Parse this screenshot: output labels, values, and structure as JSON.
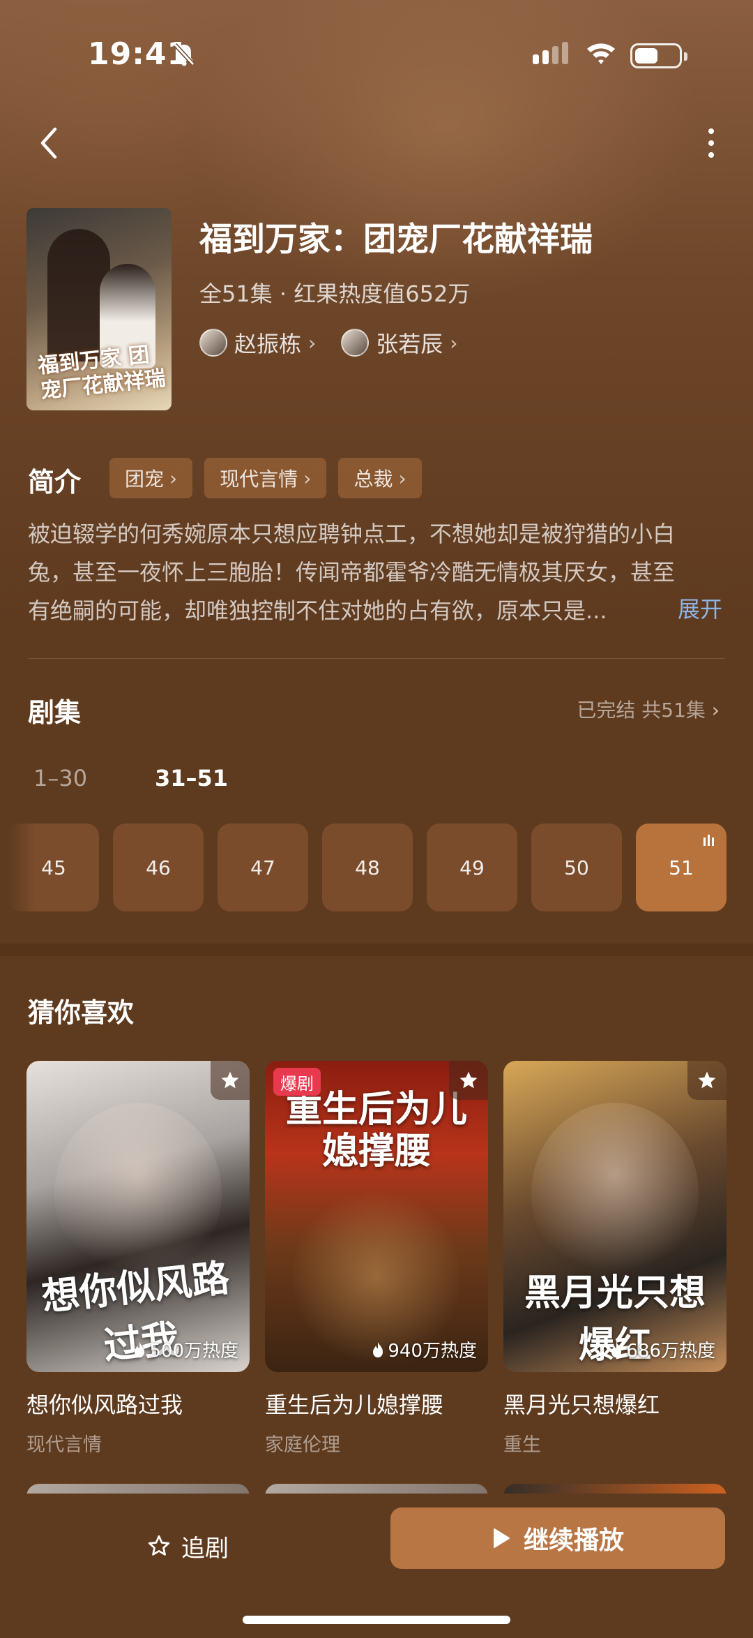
{
  "status_bar": {
    "time": "19:41"
  },
  "header": {
    "poster_text": "福到万家 团宠厂花献祥瑞",
    "title": "福到万家：团宠厂花献祥瑞",
    "meta": "全51集 · 红果热度值652万",
    "actors": [
      {
        "name": "赵振栋"
      },
      {
        "name": "张若辰"
      }
    ]
  },
  "intro": {
    "label": "简介",
    "tags": [
      "团宠",
      "现代言情",
      "总裁"
    ],
    "lines": [
      "被迫辍学的何秀婉原本只想应聘钟点工，不想她却是被狩猎的小白",
      "兔，甚至一夜怀上三胞胎！传闻帝都霍爷冷酷无情极其厌女，甚至",
      "有绝嗣的可能，却唯独控制不住对她的占有欲，原本只是..."
    ],
    "expand_label": "展开"
  },
  "episodes": {
    "label": "剧集",
    "status": "已完结 共51集",
    "ranges": [
      "1–30",
      "31–51"
    ],
    "active_range": 1,
    "visible": [
      "45",
      "46",
      "47",
      "48",
      "49",
      "50",
      "51"
    ],
    "current": "51"
  },
  "recommend": {
    "label": "猜你喜欢",
    "items": [
      {
        "name": "想你似风路过我",
        "genre": "现代言情",
        "heat": "500万热度",
        "cover_text": "想你似风路过我",
        "badge": ""
      },
      {
        "name": "重生后为儿媳撑腰",
        "genre": "家庭伦理",
        "heat": "940万热度",
        "cover_text": "重生后为儿媳撑腰",
        "badge": "爆剧"
      },
      {
        "name": "黑月光只想爆红",
        "genre": "重生",
        "heat": "686万热度",
        "cover_text": "黑月光只想爆红",
        "badge": ""
      }
    ]
  },
  "bottom_bar": {
    "follow_label": "追剧",
    "play_label": "继续播放"
  },
  "colors": {
    "background": "#5e3a1f",
    "accent": "#b87645",
    "link": "#8fb4e6",
    "hot_badge": "#e8394e"
  }
}
